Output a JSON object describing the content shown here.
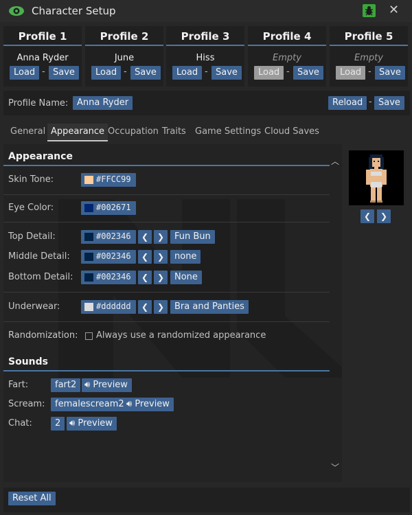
{
  "window": {
    "title": "Character Setup"
  },
  "profiles": [
    {
      "title": "Profile 1",
      "name": "Anna Ryder",
      "empty": false,
      "load_label": "Load",
      "save_label": "Save"
    },
    {
      "title": "Profile 2",
      "name": "June",
      "empty": false,
      "load_label": "Load",
      "save_label": "Save"
    },
    {
      "title": "Profile 3",
      "name": "Hiss",
      "empty": false,
      "load_label": "Load",
      "save_label": "Save"
    },
    {
      "title": "Profile 4",
      "name": "Empty",
      "empty": true,
      "load_label": "Load",
      "save_label": "Save"
    },
    {
      "title": "Profile 5",
      "name": "Empty",
      "empty": true,
      "load_label": "Load",
      "save_label": "Save"
    }
  ],
  "separator": "-",
  "profile_name": {
    "label": "Profile Name:",
    "value": "Anna Ryder",
    "reload_label": "Reload",
    "save_label": "Save"
  },
  "tabs": [
    "General",
    "Appearance",
    "Occupation",
    "Traits",
    "Game Settings",
    "Cloud Saves"
  ],
  "active_tab": "Appearance",
  "appearance": {
    "heading": "Appearance",
    "skin_tone": {
      "label": "Skin Tone:",
      "color": "#FFCC99",
      "hex": "#FFCC99"
    },
    "eye_color": {
      "label": "Eye Color:",
      "color": "#002671",
      "hex": "#002671"
    },
    "top_detail": {
      "label": "Top Detail:",
      "color": "#002346",
      "hex": "#002346",
      "option": "Fun Bun"
    },
    "middle_detail": {
      "label": "Middle Detail:",
      "color": "#002346",
      "hex": "#002346",
      "option": "none"
    },
    "bottom_detail": {
      "label": "Bottom Detail:",
      "color": "#002346",
      "hex": "#002346",
      "option": "None"
    },
    "underwear": {
      "label": "Underwear:",
      "color": "#dddddd",
      "hex": "#dddddd",
      "option": "Bra and Panties"
    },
    "randomization": {
      "label": "Randomization:",
      "checkbox_label": "Always use a randomized appearance",
      "checked": false
    }
  },
  "sounds": {
    "heading": "Sounds",
    "preview_label": "Preview",
    "fart": {
      "label": "Fart:",
      "value": "fart2"
    },
    "scream": {
      "label": "Scream:",
      "value": "femalescream2"
    },
    "chat": {
      "label": "Chat:",
      "value": "2"
    }
  },
  "footer": {
    "reset_label": "Reset All"
  },
  "colors": {
    "accent": "#3d6290",
    "header_line": "#4b77a3",
    "bug_icon": "#3aa63a",
    "eye_icon": "#4cb050"
  }
}
